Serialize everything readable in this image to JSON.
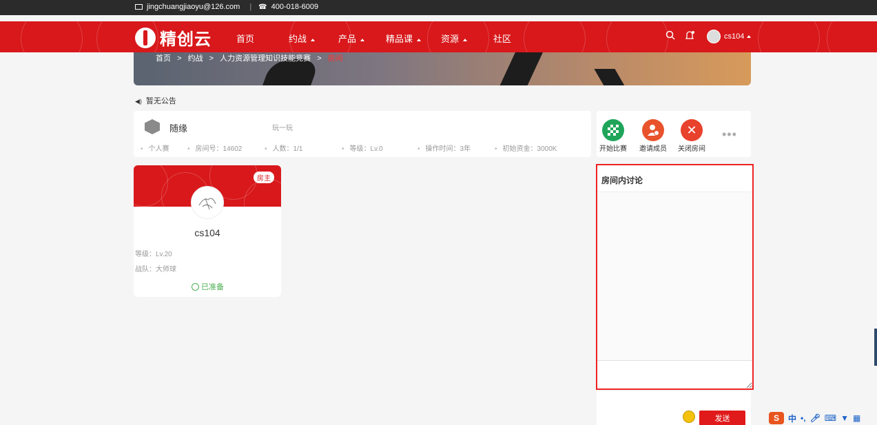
{
  "topbar": {
    "email": "jingchuangjiaoyu@126.com",
    "phone": "400-018-6009",
    "email_icon": "mail-icon",
    "phone_icon": "phone-icon"
  },
  "nav": {
    "logo_text": "精创云",
    "items": [
      {
        "label": "首页",
        "has_caret": false
      },
      {
        "label": "约战",
        "has_caret": true
      },
      {
        "label": "产品",
        "has_caret": true
      },
      {
        "label": "精品课",
        "has_caret": true
      },
      {
        "label": "资源",
        "has_caret": true
      },
      {
        "label": "社区",
        "has_caret": false
      }
    ],
    "username": "cs104"
  },
  "breadcrumb": {
    "home": "首页",
    "sep": ">",
    "level1": "约战",
    "level2": "人力资源管理知识技能竞赛",
    "current": "房间"
  },
  "notice": "暂无公告",
  "room": {
    "name": "随缘",
    "subtitle": "玩一玩",
    "mode": "个人赛",
    "room_no": "房间号：14602",
    "people": "人数：1/1",
    "level": "等级：Lv.0",
    "op_time": "操作时间：3年",
    "initial_fund": "初始资金：3000K"
  },
  "actions": {
    "start": "开始比赛",
    "invite": "邀请成员",
    "close": "关闭房间",
    "colors": {
      "start": "#1fa55a",
      "invite": "#e8532c",
      "close": "#e8412c"
    }
  },
  "player": {
    "badge": "房主",
    "name": "cs104",
    "level": "等级：Lv.20",
    "team": "战队：大师球",
    "status": "已准备"
  },
  "chat": {
    "title": "房间内讨论",
    "input_value": "",
    "send": "发送"
  },
  "ime": {
    "logo": "S",
    "mode": "中"
  },
  "colors": {
    "brand_red": "#d8181b",
    "ready_green": "#4caf50",
    "highlight_border": "#e22"
  }
}
